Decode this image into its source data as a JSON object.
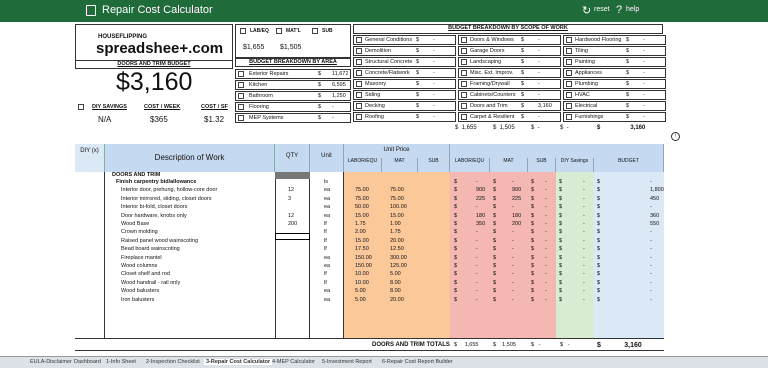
{
  "app": {
    "title": "Repair Cost Calculator",
    "reset": "reset",
    "help": "help"
  },
  "logo": {
    "top": "HOUSEFLIPPING",
    "main": "spreadshee+.com"
  },
  "header": {
    "lab_eq": "LAB/EQ",
    "matl": "MAT'L",
    "sub": "SUB",
    "lab_val": "$1,655",
    "matl_val": "$1,505",
    "doors_trim_budget": "DOORS AND TRIM BUDGET",
    "budget_total": "$3,160",
    "diy_savings": "DIY SAVINGS",
    "cost_week": "COST / WEEK",
    "cost_sf": "COST / SF",
    "diy_val": "N/A",
    "week_val": "$365",
    "sf_val": "$1.32",
    "area_title": "BUDGET BREAKDOWN BY AREA",
    "scope_title": "BUDGET BREAKDOWN BY SCOPE OF WORK"
  },
  "areas": [
    {
      "label": "Exterior Repairs",
      "value": "11,672"
    },
    {
      "label": "Kitchen",
      "value": "6,595"
    },
    {
      "label": "Bathroom",
      "value": "1,250"
    },
    {
      "label": "Flooring",
      "value": "-"
    },
    {
      "label": "MEP Systems",
      "value": "-"
    }
  ],
  "scope": [
    [
      {
        "label": "General Conditions",
        "value": "-"
      },
      {
        "label": "Doors & Windows",
        "value": "-"
      },
      {
        "label": "Hardwood Flooring",
        "value": "-"
      }
    ],
    [
      {
        "label": "Demolition",
        "value": "-"
      },
      {
        "label": "Garage Doors",
        "value": "-"
      },
      {
        "label": "Tiling",
        "value": "-"
      }
    ],
    [
      {
        "label": "Structural Concrete",
        "value": "-"
      },
      {
        "label": "Landscaping",
        "value": "-"
      },
      {
        "label": "Painting",
        "value": "-"
      }
    ],
    [
      {
        "label": "Concrete/Flatwork",
        "value": "-"
      },
      {
        "label": "Misc. Ext. Improv.",
        "value": "-"
      },
      {
        "label": "Appliances",
        "value": "-"
      }
    ],
    [
      {
        "label": "Masonry",
        "value": "-"
      },
      {
        "label": "Framing/Drywall",
        "value": "-"
      },
      {
        "label": "Plumbing",
        "value": "-"
      }
    ],
    [
      {
        "label": "Siding",
        "value": "-"
      },
      {
        "label": "Cabinets/Counters",
        "value": "-"
      },
      {
        "label": "HVAC",
        "value": "-"
      }
    ],
    [
      {
        "label": "Decking",
        "value": "-"
      },
      {
        "label": "Doors and Trim",
        "value": "3,160"
      },
      {
        "label": "Electrical",
        "value": "-"
      }
    ],
    [
      {
        "label": "Roofing",
        "value": "-"
      },
      {
        "label": "Carpet & Resilient",
        "value": "-"
      },
      {
        "label": "Furnishings",
        "value": "-"
      }
    ]
  ],
  "summary_row": {
    "lab": "1,655",
    "matl": "1,505",
    "sub": "-",
    "diy": "-",
    "budget": "3,160"
  },
  "columns": {
    "diy": "DIY (x)",
    "desc": "Description of Work",
    "qty": "QTY",
    "unit": "Unit",
    "unit_price": "Unit Price",
    "labor": "LABOR/EQU",
    "mat": "MAT",
    "sub": "SUB",
    "labor2": "LABOR/EQU",
    "mat2": "MAT",
    "sub2": "SUB",
    "diy_savings": "DIY Savings",
    "budget": "BUDGET"
  },
  "section": "DOORS AND TRIM",
  "subsection": "Finish carpentry bid/allowance",
  "rows": [
    {
      "desc": "Finish carpentry bid/allowance",
      "qty": "",
      "unit": "ls",
      "lab": "",
      "mat": "",
      "tl": "-",
      "tm": "-",
      "ts": "-",
      "diy": "-",
      "bud": "-"
    },
    {
      "desc": "Interior door, prehung, hollow-core door",
      "qty": "12",
      "unit": "ea",
      "lab": "75.00",
      "mat": "75.00",
      "tl": "900",
      "tm": "900",
      "ts": "-",
      "diy": "-",
      "bud": "1,800"
    },
    {
      "desc": "Interior mirrored, sliding, closet doors",
      "qty": "3",
      "unit": "ea",
      "lab": "75.00",
      "mat": "75.00",
      "tl": "225",
      "tm": "225",
      "ts": "-",
      "diy": "-",
      "bud": "450"
    },
    {
      "desc": "Interior bi-fold, closet doors",
      "qty": "",
      "unit": "ea",
      "lab": "50.00",
      "mat": "100.00",
      "tl": "-",
      "tm": "-",
      "ts": "-",
      "diy": "-",
      "bud": "-"
    },
    {
      "desc": "Door hardware, knobs only",
      "qty": "12",
      "unit": "ea",
      "lab": "15.00",
      "mat": "15.00",
      "tl": "180",
      "tm": "180",
      "ts": "-",
      "diy": "-",
      "bud": "360"
    },
    {
      "desc": "Wood Base",
      "qty": "200",
      "unit": "lf",
      "lab": "1.75",
      "mat": "1.00",
      "tl": "350",
      "tm": "200",
      "ts": "-",
      "diy": "-",
      "bud": "550"
    },
    {
      "desc": "Crown molding",
      "qty": "",
      "unit": "lf",
      "lab": "2.00",
      "mat": "1.75",
      "tl": "-",
      "tm": "-",
      "ts": "-",
      "diy": "-",
      "bud": "-"
    },
    {
      "desc": "Raised panel wood wainscoting",
      "qty": "",
      "unit": "lf",
      "lab": "15.00",
      "mat": "20.00",
      "tl": "-",
      "tm": "-",
      "ts": "-",
      "diy": "-",
      "bud": "-"
    },
    {
      "desc": "Bead board wainscoting",
      "qty": "",
      "unit": "lf",
      "lab": "17.50",
      "mat": "12.50",
      "tl": "-",
      "tm": "-",
      "ts": "-",
      "diy": "-",
      "bud": "-"
    },
    {
      "desc": "Fireplace mantel",
      "qty": "",
      "unit": "ea",
      "lab": "150.00",
      "mat": "300.00",
      "tl": "-",
      "tm": "-",
      "ts": "-",
      "diy": "-",
      "bud": "-"
    },
    {
      "desc": "Wood columns",
      "qty": "",
      "unit": "ea",
      "lab": "150.00",
      "mat": "125.00",
      "tl": "-",
      "tm": "-",
      "ts": "-",
      "diy": "-",
      "bud": "-"
    },
    {
      "desc": "Closet shelf and rod",
      "qty": "",
      "unit": "lf",
      "lab": "10.00",
      "mat": "5.00",
      "tl": "-",
      "tm": "-",
      "ts": "-",
      "diy": "-",
      "bud": "-"
    },
    {
      "desc": "Wood handrail - rail only",
      "qty": "",
      "unit": "lf",
      "lab": "10.00",
      "mat": "8.00",
      "tl": "-",
      "tm": "-",
      "ts": "-",
      "diy": "-",
      "bud": "-"
    },
    {
      "desc": "Wood balusters",
      "qty": "",
      "unit": "ea",
      "lab": "5.00",
      "mat": "8.00",
      "tl": "-",
      "tm": "-",
      "ts": "-",
      "diy": "-",
      "bud": "-"
    },
    {
      "desc": "Iron balusters",
      "qty": "",
      "unit": "ea",
      "lab": "5.00",
      "mat": "20.00",
      "tl": "-",
      "tm": "-",
      "ts": "-",
      "diy": "-",
      "bud": "-"
    }
  ],
  "totals": {
    "label": "DOORS AND TRIM TOTALS",
    "lab": "1,655",
    "mat": "1,505",
    "sub": "-",
    "diy": "-",
    "budget": "3,160"
  },
  "tabs": [
    "EULA-Disclaimer",
    "Dashboard",
    "1-Info Sheet",
    "2-Inspection Checklist",
    "3-Repair Cost Calculator",
    "4-MEP Calculator",
    "5-Investment Report",
    "6-Repair Cost Report Builder"
  ],
  "colors": {
    "green": "#1f6b3a",
    "orange": "#fbc89a",
    "peach": "#fde3c8",
    "red": "#f4b7b2",
    "lightgreen": "#d8ecd3",
    "blue": "#c5d9f1",
    "paleblue": "#dbe8f5"
  }
}
